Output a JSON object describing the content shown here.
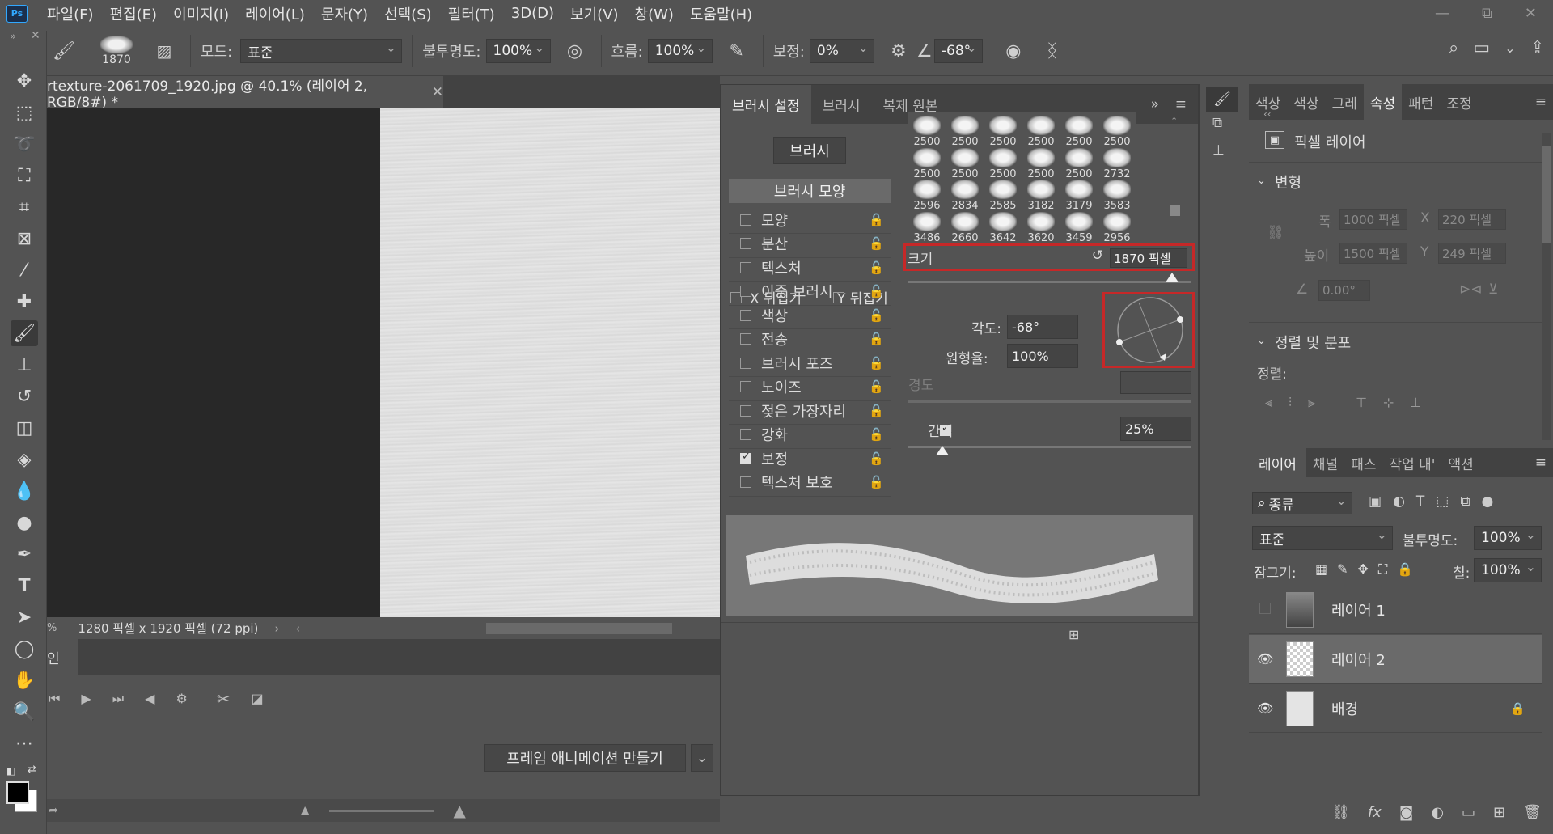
{
  "menubar": {
    "logo": "Ps",
    "items": [
      "파일(F)",
      "편집(E)",
      "이미지(I)",
      "레이어(L)",
      "문자(Y)",
      "선택(S)",
      "필터(T)",
      "3D(D)",
      "보기(V)",
      "창(W)",
      "도움말(H)"
    ],
    "window_controls": [
      "—",
      "⧉",
      "✕"
    ]
  },
  "options": {
    "brush_size": "1870",
    "mode_label": "모드:",
    "mode_value": "표준",
    "opacity_label": "불투명도:",
    "opacity_value": "100%",
    "flow_label": "흐름:",
    "flow_value": "100%",
    "smoothing_label": "보정:",
    "smoothing_value": "0%",
    "angle_value": "-68°"
  },
  "document": {
    "tab_title": "rtexture-2061709_1920.jpg @ 40.1% (레이어 2, RGB/8#) *",
    "status": "1280 픽셀 x 1920 픽셀 (72 ppi)",
    "status_prefix": "%"
  },
  "timeline": {
    "tab_label": "인",
    "create_button": "프레임 애니메이션 만들기"
  },
  "brush_panel": {
    "tabs": [
      "브러시 설정",
      "브러시",
      "복제 원본"
    ],
    "brush_button": "브러시",
    "shape_header": "브러시 모양",
    "options": [
      {
        "label": "모양",
        "checked": false
      },
      {
        "label": "분산",
        "checked": false
      },
      {
        "label": "텍스처",
        "checked": false
      },
      {
        "label": "이중 브러시",
        "checked": false
      },
      {
        "label": "색상",
        "checked": false
      },
      {
        "label": "전송",
        "checked": false
      },
      {
        "label": "브러시 포즈",
        "checked": false
      },
      {
        "label": "노이즈",
        "checked": false
      },
      {
        "label": "젖은 가장자리",
        "checked": false
      },
      {
        "label": "강화",
        "checked": false
      },
      {
        "label": "보정",
        "checked": true
      },
      {
        "label": "텍스처 보호",
        "checked": false
      }
    ],
    "presets": [
      "2500",
      "2500",
      "2500",
      "2500",
      "2500",
      "2500",
      "2500",
      "2500",
      "2500",
      "2500",
      "2500",
      "2732",
      "2596",
      "2834",
      "2585",
      "3182",
      "3179",
      "3583",
      "3486",
      "2660",
      "3642",
      "3620",
      "3459",
      "2956"
    ],
    "size_label": "크기",
    "size_value": "1870 픽셀",
    "flip_x": "X 뒤집기",
    "flip_y": "Y 뒤집기",
    "angle_label": "각도:",
    "angle_value": "-68°",
    "roundness_label": "원형율:",
    "roundness_value": "100%",
    "hardness_label": "경도",
    "spacing_label": "간격",
    "spacing_value": "25%",
    "size_slider_fraction": 0.93,
    "spacing_slider_fraction": 0.12
  },
  "properties": {
    "tabs": [
      "색상",
      "색상",
      "그레",
      "속성",
      "패턴",
      "조정"
    ],
    "layer_type": "픽셀 레이어",
    "transform_header": "변형",
    "width_label": "폭",
    "width_value": "1000 픽셀",
    "x_label": "X",
    "x_value": "220 픽셀",
    "height_label": "높이",
    "height_value": "1500 픽셀",
    "y_label": "Y",
    "y_value": "249 픽셀",
    "angle_value": "0.00°",
    "align_header": "정렬 및 분포",
    "align_label": "정렬:"
  },
  "layers": {
    "tabs": [
      "레이어",
      "채널",
      "패스",
      "작업 내'",
      "액션"
    ],
    "filter_label": "종류",
    "blend_mode": "표준",
    "opacity_label": "불투명도:",
    "opacity_value": "100%",
    "lock_label": "잠그기:",
    "fill_label": "칠:",
    "fill_value": "100%",
    "items": [
      {
        "name": "레이어 1",
        "visible": false
      },
      {
        "name": "레이어 2",
        "visible": true
      },
      {
        "name": "배경",
        "visible": true
      }
    ]
  },
  "colors": {
    "accent_red": "#c62828",
    "panel": "#535353",
    "dark": "#424242"
  }
}
